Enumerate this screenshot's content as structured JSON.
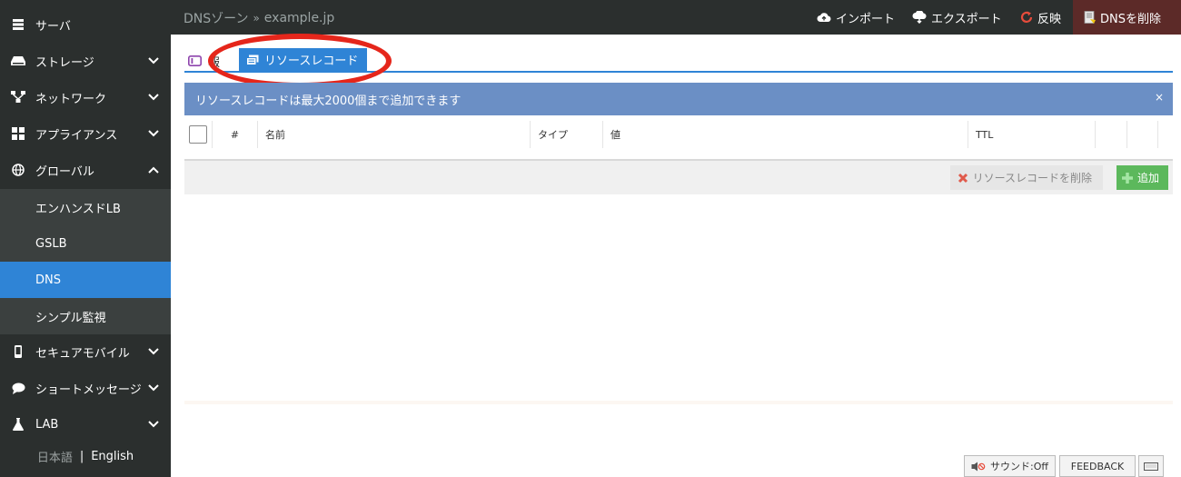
{
  "sidebar": {
    "items": [
      {
        "label": "サーバ",
        "icon": "server-icon"
      },
      {
        "label": "ストレージ",
        "icon": "storage-icon"
      },
      {
        "label": "ネットワーク",
        "icon": "network-icon"
      },
      {
        "label": "アプライアンス",
        "icon": "appliance-icon"
      },
      {
        "label": "グローバル",
        "icon": "globe-icon"
      }
    ],
    "subitems": [
      {
        "label": "エンハンスドLB"
      },
      {
        "label": "GSLB"
      },
      {
        "label": "DNS",
        "active": true
      },
      {
        "label": "シンプル監視"
      }
    ],
    "items2": [
      {
        "label": "セキュアモバイル",
        "icon": "mobile-icon"
      },
      {
        "label": "ショートメッセージ",
        "icon": "chat-icon"
      },
      {
        "label": "LAB",
        "icon": "flask-icon"
      }
    ],
    "lang": {
      "ja": "日本語",
      "sep": "|",
      "en": "English"
    }
  },
  "header": {
    "breadcrumb_root": "DNSゾーン",
    "breadcrumb_sep": "»",
    "breadcrumb_current": "example.jp",
    "import_label": "インポート",
    "export_label": "エクスポート",
    "apply_label": "反映",
    "delete_dns_label": "DNSを削除"
  },
  "tabs": {
    "info_label": "報",
    "rr_label": "リソースレコード"
  },
  "alert": {
    "message": "リソースレコードは最大2000個まで追加できます",
    "close": "×"
  },
  "table": {
    "columns": [
      "#",
      "名前",
      "タイプ",
      "値",
      "TTL"
    ]
  },
  "toolbar": {
    "delete_rr_label": "リソースレコードを削除",
    "add_label": "追加"
  },
  "footer": {
    "sound_label": "サウンド:Off",
    "feedback_label": "FEEDBACK"
  },
  "colors": {
    "sidebar_bg": "#2b2f2e",
    "active": "#2f84d6",
    "alert": "#6b8fc5",
    "add": "#5cb85c",
    "highlight": "#e5261b"
  }
}
